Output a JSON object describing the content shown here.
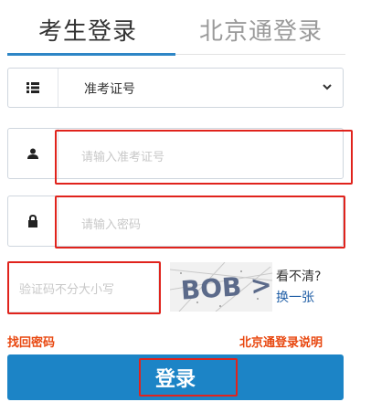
{
  "tabs": {
    "exam_login": "考生登录",
    "beijing_login": "北京通登录"
  },
  "form": {
    "id_type": {
      "selected": "准考证号"
    },
    "exam_number": {
      "placeholder": "请输入准考证号"
    },
    "password": {
      "placeholder": "请输入密码"
    },
    "captcha": {
      "placeholder": "验证码不分大小写",
      "image_text": "BOB >",
      "cant_see": "看不清?",
      "change": "换一张"
    }
  },
  "links": {
    "forgot_password": "找回密码",
    "beijing_help": "北京通登录说明"
  },
  "submit": {
    "label": "登录"
  },
  "colors": {
    "accent": "#1c84c6",
    "highlight_red": "#e0231c",
    "link_orange": "#e8470f"
  }
}
